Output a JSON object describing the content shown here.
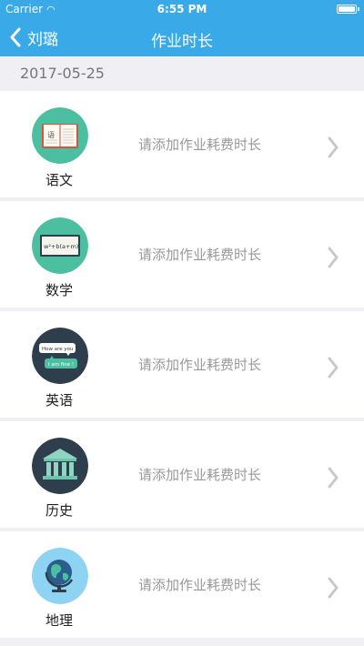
{
  "status": {
    "carrier": "Carrier",
    "time": "6:55 PM"
  },
  "nav": {
    "back_label": "刘璐",
    "title": "作业时长"
  },
  "date": "2017-05-25",
  "rows": [
    {
      "subject": "语文",
      "hint": "请添加作业耗费时长",
      "icon": "book-icon",
      "color": "#4bbfa0",
      "book_label": "语"
    },
    {
      "subject": "数学",
      "hint": "请添加作业耗费时长",
      "icon": "math-board-icon",
      "color": "#4bbfa0",
      "board_text": "w²+b(a+m)"
    },
    {
      "subject": "英语",
      "hint": "请添加作业耗费时长",
      "icon": "speech-bubbles-icon",
      "color": "#2f3e4c",
      "bubble1": "How are you ?",
      "bubble2": "I am fine !"
    },
    {
      "subject": "历史",
      "hint": "请添加作业耗费时长",
      "icon": "museum-icon",
      "color": "#2f3e4c"
    },
    {
      "subject": "地理",
      "hint": "请添加作业耗费时长",
      "icon": "globe-icon",
      "color": "#8ed3f1"
    }
  ]
}
